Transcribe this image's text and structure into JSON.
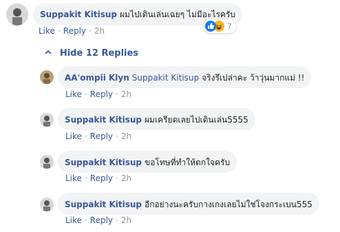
{
  "main_comment": {
    "author": "Suppakit Kitisup",
    "text": "ผมไปเดินเล่นเฉยๆ ไม่มีอะไรครับ",
    "actions": {
      "like": "Like",
      "reply": "Reply",
      "time": "2h",
      "sep": "·"
    },
    "reactions": {
      "count": "7",
      "icons": [
        "like-icon",
        "haha-icon"
      ]
    }
  },
  "hide_replies": {
    "label": "Hide 12 Replies",
    "icon": "chevron-up-icon"
  },
  "replies": [
    {
      "author": "AA'ompii Klyn",
      "mention": "Suppakit Kitisup",
      "text": "จริงรึเปล่าคะ ว้าวุ่นมากแม่ !!",
      "actions": {
        "like": "Like",
        "reply": "Reply",
        "time": "2h",
        "sep": "·"
      }
    },
    {
      "author": "Suppakit Kitisup",
      "text": "ผมเครียดเลยไปเดินเล่น5555",
      "actions": {
        "like": "Like",
        "reply": "Reply",
        "time": "2h",
        "sep": "·"
      }
    },
    {
      "author": "Suppakit Kitisup",
      "text": "ขอโทษที่ทำให้ตกใจครับ",
      "actions": {
        "like": "Like",
        "reply": "Reply",
        "time": "2h",
        "sep": "·"
      }
    },
    {
      "author": "Suppakit Kitisup",
      "text": "อีกอย่างนะครับกางเกงเลยไม่ใช่โจงกระเบน555",
      "actions": {
        "like": "Like",
        "reply": "Reply",
        "time": "2h",
        "sep": "·"
      }
    }
  ],
  "colors": {
    "link": "#385898",
    "meta": "#90949c",
    "bubble_bg": "#f2f3f5",
    "like_blue": "#1877f2",
    "haha_yellow": "#f7b125"
  }
}
